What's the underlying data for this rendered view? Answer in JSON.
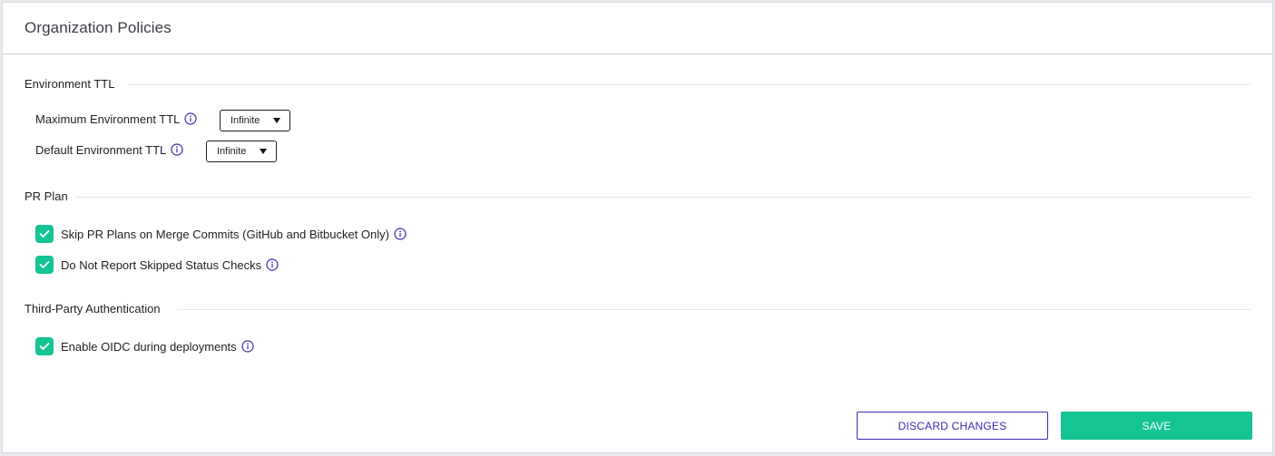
{
  "card": {
    "title": "Organization Policies"
  },
  "sections": {
    "environment_ttl": {
      "title": "Environment TTL",
      "max_ttl": {
        "label": "Maximum Environment TTL",
        "value": "Infinite"
      },
      "default_ttl": {
        "label": "Default Environment TTL",
        "value": "Infinite"
      }
    },
    "pr_plan": {
      "title": "PR Plan",
      "skip_merge_commits": {
        "label": "Skip PR Plans on Merge Commits (GitHub and Bitbucket Only)",
        "checked": true
      },
      "no_report_skipped": {
        "label": "Do Not Report Skipped Status Checks",
        "checked": true
      }
    },
    "third_party_auth": {
      "title": "Third-Party Authentication",
      "enable_oidc": {
        "label": "Enable OIDC during deployments",
        "checked": true
      }
    }
  },
  "actions": {
    "discard_label": "DISCARD CHANGES",
    "save_label": "SAVE"
  },
  "colors": {
    "accent_green": "#14c493",
    "accent_purple": "#3a2bb5",
    "info_icon": "#3a2bb5"
  },
  "icons": {
    "info": "info-circle-icon",
    "check": "checkmark-icon",
    "dropdown": "caret-down-icon"
  }
}
